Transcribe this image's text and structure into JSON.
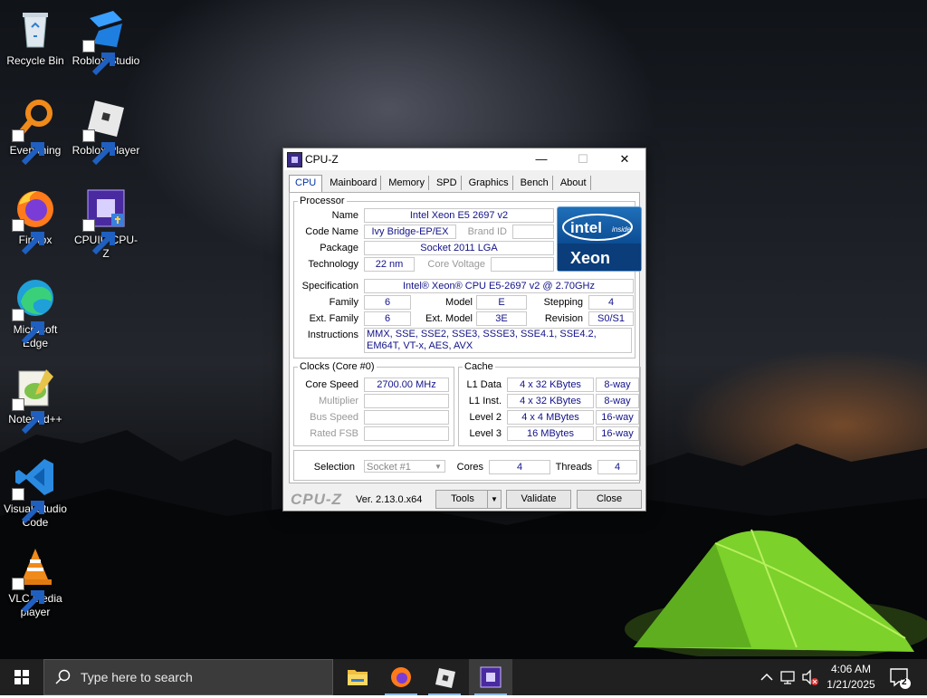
{
  "desktop": {
    "icons": [
      {
        "label": "Recycle Bin",
        "icon": "recycle-bin-icon"
      },
      {
        "label": "Roblox Studio",
        "icon": "roblox-studio-icon"
      },
      {
        "label": "Everything",
        "icon": "everything-search-icon"
      },
      {
        "label": "Roblox Player",
        "icon": "roblox-player-icon"
      },
      {
        "label": "Firefox",
        "icon": "firefox-icon"
      },
      {
        "label": "CPUID CPU-Z",
        "icon": "cpuz-icon"
      },
      {
        "label": "Microsoft Edge",
        "icon": "edge-icon"
      },
      {
        "label": "Notepad++",
        "icon": "notepadpp-icon"
      },
      {
        "label": "Visual Studio Code",
        "icon": "vscode-icon"
      },
      {
        "label": "VLC media player",
        "icon": "vlc-icon"
      }
    ]
  },
  "cpuz": {
    "title": "CPU-Z",
    "tabs": [
      "CPU",
      "Mainboard",
      "Memory",
      "SPD",
      "Graphics",
      "Bench",
      "About"
    ],
    "active_tab": "CPU",
    "processor": {
      "legend": "Processor",
      "name_label": "Name",
      "name": "Intel Xeon E5 2697 v2",
      "codename_label": "Code Name",
      "codename": "Ivy Bridge-EP/EX",
      "brandid_label": "Brand ID",
      "brandid": "",
      "package_label": "Package",
      "package": "Socket 2011 LGA",
      "technology_label": "Technology",
      "technology": "22 nm",
      "corevoltage_label": "Core Voltage",
      "corevoltage": "",
      "spec_label": "Specification",
      "spec": "Intel® Xeon® CPU E5-2697 v2 @ 2.70GHz",
      "family_label": "Family",
      "family": "6",
      "model_label": "Model",
      "model": "E",
      "stepping_label": "Stepping",
      "stepping": "4",
      "extfamily_label": "Ext. Family",
      "extfamily": "6",
      "extmodel_label": "Ext. Model",
      "extmodel": "3E",
      "revision_label": "Revision",
      "revision": "S0/S1",
      "instructions_label": "Instructions",
      "instructions": "MMX, SSE, SSE2, SSE3, SSSE3, SSE4.1, SSE4.2, EM64T, VT-x, AES, AVX"
    },
    "logo": {
      "brand": "intel",
      "inside": "inside",
      "product": "Xeon"
    },
    "clocks": {
      "legend": "Clocks (Core #0)",
      "corespeed_label": "Core Speed",
      "corespeed": "2700.00 MHz",
      "multiplier_label": "Multiplier",
      "multiplier": "",
      "busspeed_label": "Bus Speed",
      "busspeed": "",
      "ratedfsb_label": "Rated FSB",
      "ratedfsb": ""
    },
    "cache": {
      "legend": "Cache",
      "rows": [
        {
          "label": "L1 Data",
          "size": "4 x 32 KBytes",
          "assoc": "8-way"
        },
        {
          "label": "L1 Inst.",
          "size": "4 x 32 KBytes",
          "assoc": "8-way"
        },
        {
          "label": "Level 2",
          "size": "4 x 4 MBytes",
          "assoc": "16-way"
        },
        {
          "label": "Level 3",
          "size": "16 MBytes",
          "assoc": "16-way"
        }
      ]
    },
    "selection": {
      "label": "Selection",
      "value": "Socket #1",
      "cores_label": "Cores",
      "cores": "4",
      "threads_label": "Threads",
      "threads": "4"
    },
    "footer": {
      "brand": "CPU-Z",
      "version": "Ver. 2.13.0.x64",
      "tools": "Tools",
      "validate": "Validate",
      "close": "Close"
    }
  },
  "taskbar": {
    "search_placeholder": "Type here to search",
    "pinned": [
      "file-explorer-icon",
      "firefox-icon",
      "roblox-icon",
      "cpuz-icon"
    ],
    "time": "4:06 AM",
    "date": "1/21/2025",
    "notifications": "2"
  }
}
